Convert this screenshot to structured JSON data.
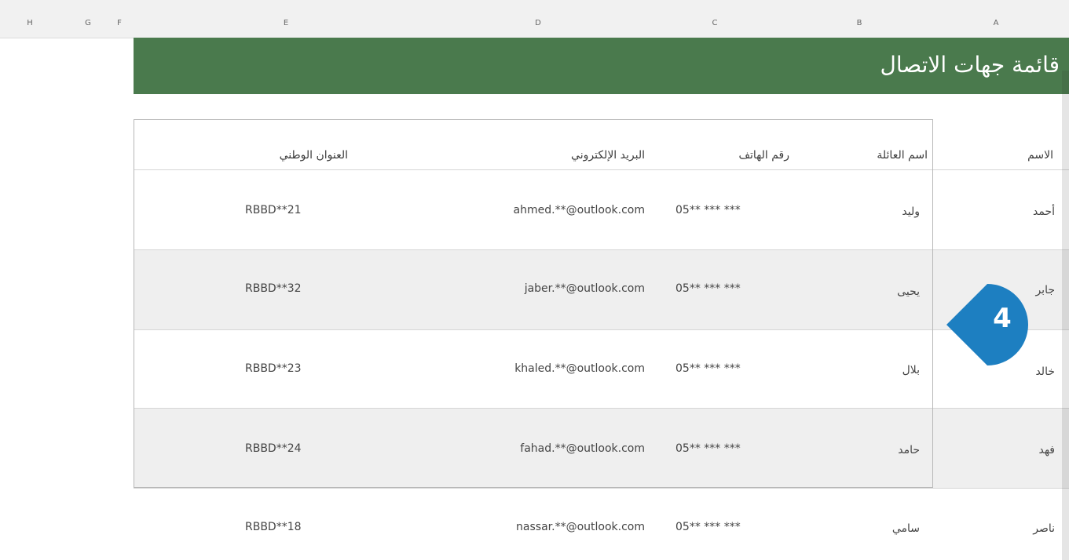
{
  "columns": {
    "H": "H",
    "G": "G",
    "F": "F",
    "E": "E",
    "D": "D",
    "C": "C",
    "B": "B",
    "A": "A"
  },
  "sheet_title": "قائمة جهات الاتصال",
  "table": {
    "headers": {
      "name": "الاسم",
      "family": "اسم العائلة",
      "phone": "رقم الهاتف",
      "email": "البريد الإلكتروني",
      "address": "العنوان الوطني"
    },
    "rows": [
      {
        "name": "أحمد",
        "family": "وليد",
        "phone": "05** *** ***",
        "email": "ahmed.**@outlook.com",
        "address": "RBBD**21"
      },
      {
        "name": "جابر",
        "family": "يحيى",
        "phone": "05** *** ***",
        "email": "jaber.**@outlook.com",
        "address": "RBBD**32"
      },
      {
        "name": "خالد",
        "family": "بلال",
        "phone": "05** *** ***",
        "email": "khaled.**@outlook.com",
        "address": "RBBD**23"
      },
      {
        "name": "فهد",
        "family": "حامد",
        "phone": "05** *** ***",
        "email": "fahad.**@outlook.com",
        "address": "RBBD**24"
      },
      {
        "name": "ناصر",
        "family": "سامي",
        "phone": "05** *** ***",
        "email": "nassar.**@outlook.com",
        "address": "RBBD**18"
      }
    ]
  },
  "callout": {
    "number": "4",
    "color": "#1d7fc1"
  },
  "colors": {
    "title_band": "#4a7a4d",
    "alt_row": "#efefef"
  }
}
